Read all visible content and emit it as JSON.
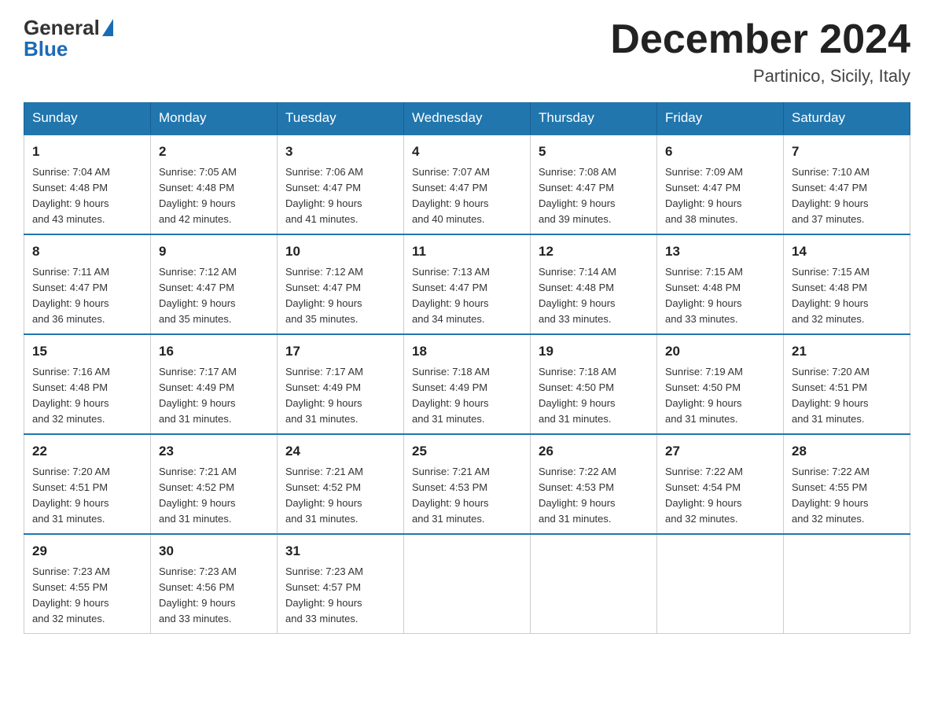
{
  "header": {
    "logo_general": "General",
    "logo_blue": "Blue",
    "month_title": "December 2024",
    "location": "Partinico, Sicily, Italy"
  },
  "days_of_week": [
    "Sunday",
    "Monday",
    "Tuesday",
    "Wednesday",
    "Thursday",
    "Friday",
    "Saturday"
  ],
  "weeks": [
    [
      {
        "day": "1",
        "sunrise": "7:04 AM",
        "sunset": "4:48 PM",
        "daylight": "9 hours and 43 minutes."
      },
      {
        "day": "2",
        "sunrise": "7:05 AM",
        "sunset": "4:48 PM",
        "daylight": "9 hours and 42 minutes."
      },
      {
        "day": "3",
        "sunrise": "7:06 AM",
        "sunset": "4:47 PM",
        "daylight": "9 hours and 41 minutes."
      },
      {
        "day": "4",
        "sunrise": "7:07 AM",
        "sunset": "4:47 PM",
        "daylight": "9 hours and 40 minutes."
      },
      {
        "day": "5",
        "sunrise": "7:08 AM",
        "sunset": "4:47 PM",
        "daylight": "9 hours and 39 minutes."
      },
      {
        "day": "6",
        "sunrise": "7:09 AM",
        "sunset": "4:47 PM",
        "daylight": "9 hours and 38 minutes."
      },
      {
        "day": "7",
        "sunrise": "7:10 AM",
        "sunset": "4:47 PM",
        "daylight": "9 hours and 37 minutes."
      }
    ],
    [
      {
        "day": "8",
        "sunrise": "7:11 AM",
        "sunset": "4:47 PM",
        "daylight": "9 hours and 36 minutes."
      },
      {
        "day": "9",
        "sunrise": "7:12 AM",
        "sunset": "4:47 PM",
        "daylight": "9 hours and 35 minutes."
      },
      {
        "day": "10",
        "sunrise": "7:12 AM",
        "sunset": "4:47 PM",
        "daylight": "9 hours and 35 minutes."
      },
      {
        "day": "11",
        "sunrise": "7:13 AM",
        "sunset": "4:47 PM",
        "daylight": "9 hours and 34 minutes."
      },
      {
        "day": "12",
        "sunrise": "7:14 AM",
        "sunset": "4:48 PM",
        "daylight": "9 hours and 33 minutes."
      },
      {
        "day": "13",
        "sunrise": "7:15 AM",
        "sunset": "4:48 PM",
        "daylight": "9 hours and 33 minutes."
      },
      {
        "day": "14",
        "sunrise": "7:15 AM",
        "sunset": "4:48 PM",
        "daylight": "9 hours and 32 minutes."
      }
    ],
    [
      {
        "day": "15",
        "sunrise": "7:16 AM",
        "sunset": "4:48 PM",
        "daylight": "9 hours and 32 minutes."
      },
      {
        "day": "16",
        "sunrise": "7:17 AM",
        "sunset": "4:49 PM",
        "daylight": "9 hours and 31 minutes."
      },
      {
        "day": "17",
        "sunrise": "7:17 AM",
        "sunset": "4:49 PM",
        "daylight": "9 hours and 31 minutes."
      },
      {
        "day": "18",
        "sunrise": "7:18 AM",
        "sunset": "4:49 PM",
        "daylight": "9 hours and 31 minutes."
      },
      {
        "day": "19",
        "sunrise": "7:18 AM",
        "sunset": "4:50 PM",
        "daylight": "9 hours and 31 minutes."
      },
      {
        "day": "20",
        "sunrise": "7:19 AM",
        "sunset": "4:50 PM",
        "daylight": "9 hours and 31 minutes."
      },
      {
        "day": "21",
        "sunrise": "7:20 AM",
        "sunset": "4:51 PM",
        "daylight": "9 hours and 31 minutes."
      }
    ],
    [
      {
        "day": "22",
        "sunrise": "7:20 AM",
        "sunset": "4:51 PM",
        "daylight": "9 hours and 31 minutes."
      },
      {
        "day": "23",
        "sunrise": "7:21 AM",
        "sunset": "4:52 PM",
        "daylight": "9 hours and 31 minutes."
      },
      {
        "day": "24",
        "sunrise": "7:21 AM",
        "sunset": "4:52 PM",
        "daylight": "9 hours and 31 minutes."
      },
      {
        "day": "25",
        "sunrise": "7:21 AM",
        "sunset": "4:53 PM",
        "daylight": "9 hours and 31 minutes."
      },
      {
        "day": "26",
        "sunrise": "7:22 AM",
        "sunset": "4:53 PM",
        "daylight": "9 hours and 31 minutes."
      },
      {
        "day": "27",
        "sunrise": "7:22 AM",
        "sunset": "4:54 PM",
        "daylight": "9 hours and 32 minutes."
      },
      {
        "day": "28",
        "sunrise": "7:22 AM",
        "sunset": "4:55 PM",
        "daylight": "9 hours and 32 minutes."
      }
    ],
    [
      {
        "day": "29",
        "sunrise": "7:23 AM",
        "sunset": "4:55 PM",
        "daylight": "9 hours and 32 minutes."
      },
      {
        "day": "30",
        "sunrise": "7:23 AM",
        "sunset": "4:56 PM",
        "daylight": "9 hours and 33 minutes."
      },
      {
        "day": "31",
        "sunrise": "7:23 AM",
        "sunset": "4:57 PM",
        "daylight": "9 hours and 33 minutes."
      },
      null,
      null,
      null,
      null
    ]
  ],
  "labels": {
    "sunrise": "Sunrise:",
    "sunset": "Sunset:",
    "daylight": "Daylight:"
  }
}
